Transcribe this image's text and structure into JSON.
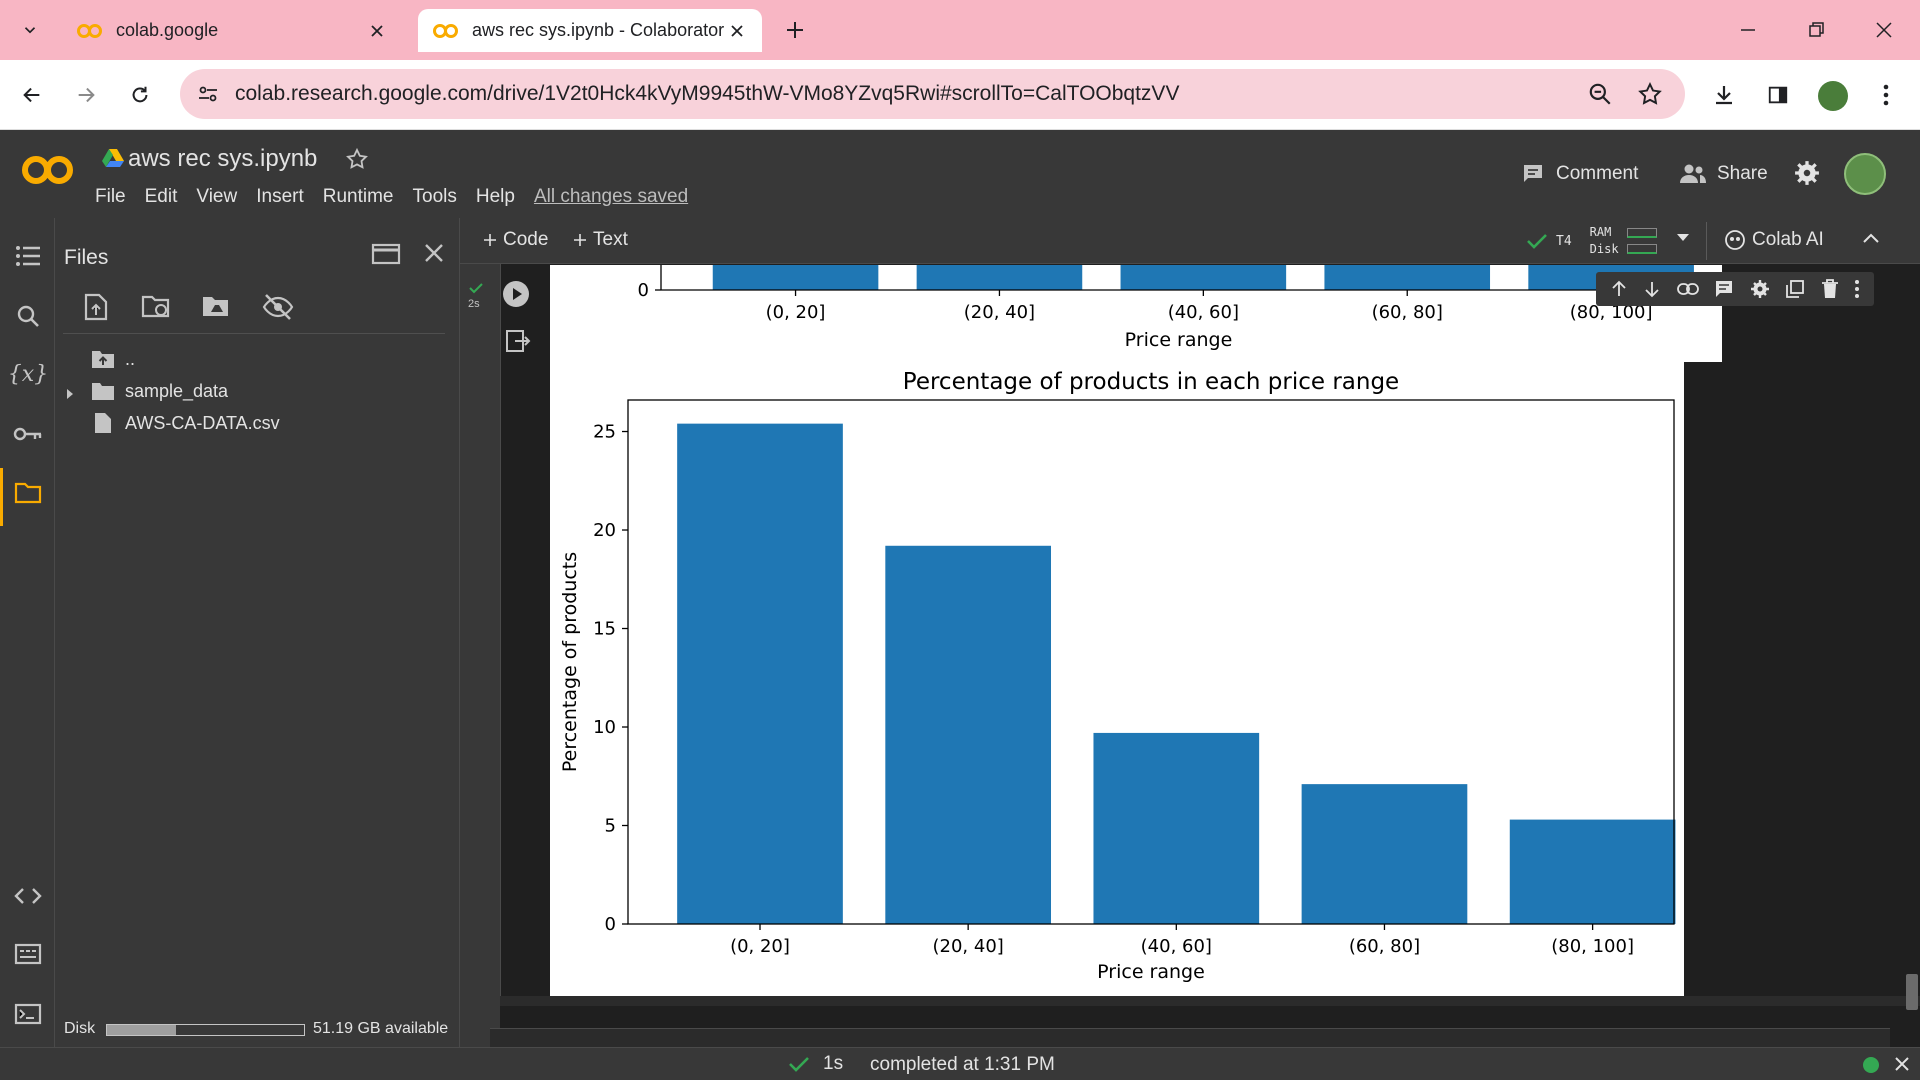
{
  "browser": {
    "tabs": [
      {
        "title": "colab.google",
        "active": false
      },
      {
        "title": "aws rec sys.ipynb - Colaborator",
        "active": true
      }
    ],
    "url": "colab.research.google.com/drive/1V2t0Hck4kVyM9945thW-VMo8YZvq5Rwi#scrollTo=CalTOObqtzVV"
  },
  "colab": {
    "logo": "CO",
    "doc_title": "aws rec sys.ipynb",
    "menu": [
      "File",
      "Edit",
      "View",
      "Insert",
      "Runtime",
      "Tools",
      "Help"
    ],
    "saved_status": "All changes saved",
    "comment_label": "Comment",
    "share_label": "Share"
  },
  "files_panel": {
    "title": "Files",
    "items": [
      {
        "name": "..",
        "type": "parent-folder"
      },
      {
        "name": "sample_data",
        "type": "folder"
      },
      {
        "name": "AWS-CA-DATA.csv",
        "type": "file"
      }
    ],
    "disk_label": "Disk",
    "disk_available": "51.19 GB available",
    "disk_used_fraction": 0.35
  },
  "notebook_toolbar": {
    "code_label": "Code",
    "text_label": "Text",
    "runtime": "T4",
    "ram_label": "RAM",
    "disk_label": "Disk",
    "colab_ai_label": "Colab AI"
  },
  "cell": {
    "exec_time": "2s"
  },
  "statusbar": {
    "duration": "1s",
    "completed": "completed at 1:31 PM"
  },
  "top_chart": {
    "categories": [
      "(0, 20]",
      "(20, 40]",
      "(40, 60]",
      "(60, 80]",
      "(80, 100]"
    ],
    "xlabel": "Price range",
    "y_tick": "0"
  },
  "chart_data": {
    "type": "bar",
    "title": "Percentage of products in each price range",
    "xlabel": "Price range",
    "ylabel": "Percentage of products",
    "categories": [
      "(0, 20]",
      "(20, 40]",
      "(40, 60]",
      "(60, 80]",
      "(80, 100]"
    ],
    "values": [
      25.4,
      19.2,
      9.7,
      7.1,
      5.3
    ],
    "ylim": [
      0,
      26.6
    ],
    "yticks": [
      0,
      5,
      10,
      15,
      20,
      25
    ],
    "bar_color": "#1f77b4",
    "grid": false
  },
  "colors": {
    "accent": "#f9ab00",
    "bar": "#1f77b4",
    "dark_bg": "#383838"
  }
}
